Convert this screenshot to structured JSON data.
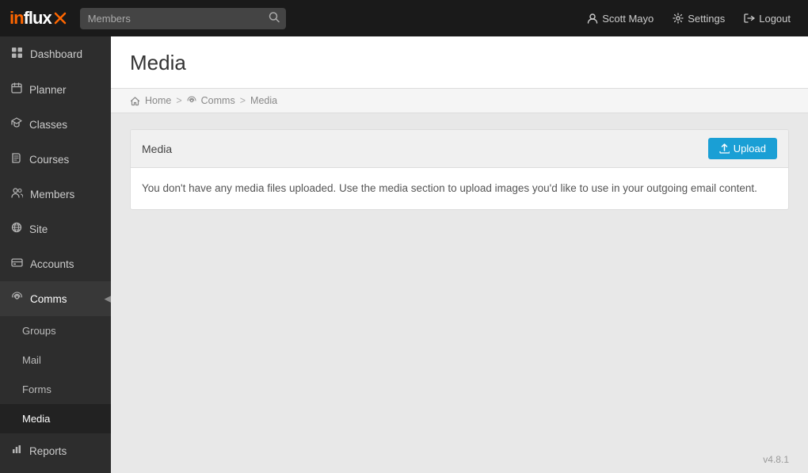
{
  "app": {
    "logo": "influx",
    "logo_symbol": "✕"
  },
  "topnav": {
    "search_placeholder": "Members",
    "search_icon": "🔍",
    "user_label": "Scott Mayo",
    "settings_label": "Settings",
    "logout_label": "Logout",
    "user_icon": "👤",
    "settings_icon": "🔧",
    "logout_icon": "→"
  },
  "sidebar": {
    "items": [
      {
        "id": "dashboard",
        "label": "Dashboard",
        "icon": "⊞"
      },
      {
        "id": "planner",
        "label": "Planner",
        "icon": "📅"
      },
      {
        "id": "classes",
        "label": "Classes",
        "icon": "🔔"
      },
      {
        "id": "courses",
        "label": "Courses",
        "icon": "📖"
      },
      {
        "id": "members",
        "label": "Members",
        "icon": "👤"
      },
      {
        "id": "site",
        "label": "Site",
        "icon": "○"
      },
      {
        "id": "accounts",
        "label": "Accounts",
        "icon": "🗂"
      },
      {
        "id": "comms",
        "label": "Comms",
        "icon": "📡",
        "active": true,
        "expanded": true
      },
      {
        "id": "reports",
        "label": "Reports",
        "icon": "📊"
      }
    ],
    "sub_items": [
      {
        "id": "groups",
        "label": "Groups"
      },
      {
        "id": "mail",
        "label": "Mail"
      },
      {
        "id": "forms",
        "label": "Forms"
      },
      {
        "id": "media",
        "label": "Media",
        "active": true
      }
    ]
  },
  "page": {
    "title": "Media",
    "breadcrumb": {
      "home_label": "Home",
      "comms_label": "Comms",
      "current_label": "Media",
      "sep": ">"
    }
  },
  "media_card": {
    "title": "Media",
    "upload_label": "Upload",
    "empty_message": "You don't have any media files uploaded. Use the media section to upload images you'd like to use in your outgoing email content."
  },
  "version": "v4.8.1"
}
